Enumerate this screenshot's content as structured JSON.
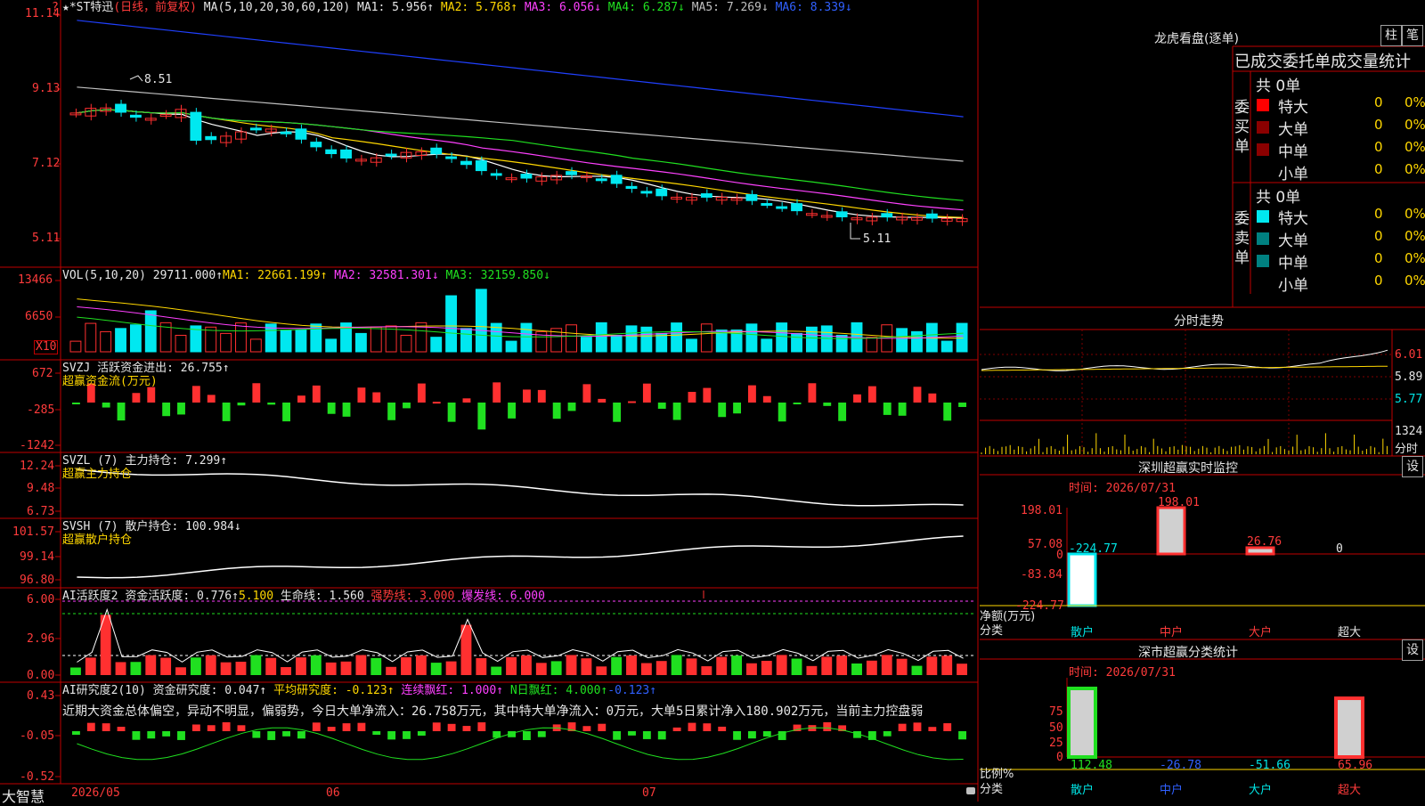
{
  "main_chart": {
    "header": {
      "name": "★*ST特迅",
      "period": "(日线，前复权)",
      "ma_label": "MA(5,10,20,30,60,120)",
      "ma1": "MA1: 5.956↑",
      "ma2": "MA2: 5.768↑",
      "ma3": "MA3: 6.056↓",
      "ma4": "MA4: 6.287↓",
      "ma5": "MA5: 7.269↓",
      "ma6": "MA6: 8.339↓"
    },
    "axis_labels": [
      "11.14",
      "9.13",
      "7.12",
      "5.11"
    ],
    "high_marker": "8.51",
    "low_marker": "5.11",
    "help_icon": "?"
  },
  "vol_panel": {
    "header": "VOL(5,10,20)",
    "val": "29711.000↑",
    "ma1": "MA1: 22661.199↑",
    "ma2": "MA2: 32581.301↓",
    "ma3": "MA3: 32159.850↓",
    "axis_labels": [
      "13466",
      "6650"
    ],
    "unit": "X10"
  },
  "svzj_panel": {
    "header": "SVZJ  活跃资金进出: 26.755↑",
    "sub": "超赢资金流(万元)",
    "axis_labels": [
      "672",
      "-285",
      "-1242"
    ]
  },
  "svzl_panel": {
    "header": "SVZL (7) 主力持仓: 7.299↑",
    "sub": "超赢主力持仓",
    "axis_labels": [
      "12.24",
      "9.48",
      "6.73"
    ]
  },
  "svsh_panel": {
    "header": "SVSH (7) 散户持仓: 100.984↓",
    "sub": "超赢散户持仓",
    "axis_labels": [
      "101.57",
      "99.14",
      "96.80"
    ]
  },
  "ai_active_panel": {
    "title": "AI活跃度2",
    "a1": "资金活跃度: 0.776↑",
    "a2": "5.100",
    "a3": "生命线: 1.560",
    "a4": "强势线: 3.000",
    "a5": "爆发线: 6.000",
    "axis_labels": [
      "6.00",
      "2.96",
      "0.00"
    ]
  },
  "ai_research_panel": {
    "title": "AI研究度2(10)",
    "r1": "资金研究度: 0.047↑",
    "r2": "平均研究度: -0.123↑",
    "r3": "连续飘红: 1.000↑",
    "r4": "N日飘红: 4.000↑",
    "r5": "-0.123↑",
    "commentary": "近期大资金总体偏空，异动不明显，偏弱势，今日大单净流入：26.758万元，其中特大单净流入：0万元，大单5日累计净入180.902万元，当前主力控盘弱",
    "axis_labels": [
      "0.43",
      "-0.05",
      "-0.52"
    ]
  },
  "bottom_bar": {
    "brand": "大智慧",
    "dates": [
      "2026/05",
      "06",
      "07"
    ]
  },
  "dragon_tiger": {
    "title": "龙虎看盘(逐单)",
    "btn1": "柱",
    "btn2": "笔",
    "subtitle": "已成交委托单成交量统计",
    "buy_group": {
      "side_label": [
        "委",
        "买",
        "单"
      ],
      "total": "共 0单",
      "rows": [
        {
          "label": "特大",
          "count": "0",
          "pct": "0%"
        },
        {
          "label": "大单",
          "count": "0",
          "pct": "0%"
        },
        {
          "label": "中单",
          "count": "0",
          "pct": "0%"
        },
        {
          "label": "小单",
          "count": "0",
          "pct": "0%"
        }
      ]
    },
    "sell_group": {
      "side_label": [
        "委",
        "卖",
        "单"
      ],
      "total": "共 0单",
      "rows": [
        {
          "label": "特大",
          "count": "0",
          "pct": "0%"
        },
        {
          "label": "大单",
          "count": "0",
          "pct": "0%"
        },
        {
          "label": "中单",
          "count": "0",
          "pct": "0%"
        },
        {
          "label": "小单",
          "count": "0",
          "pct": "0%"
        }
      ]
    }
  },
  "intraday": {
    "title": "分时走势",
    "price_labels": [
      "6.01",
      "5.89",
      "5.77"
    ],
    "vol_label": "1324",
    "vol_unit": "分时"
  },
  "sz_monitor": {
    "title": "深圳超赢实时监控",
    "settings": "设",
    "time": "时间: 2026/07/31",
    "axis_labels": [
      "198.01",
      "57.08",
      "0",
      "-83.84",
      "-224.77"
    ],
    "y_unit": "净额(万元)",
    "x_unit": "分类",
    "values": [
      "-224.77",
      "198.01",
      "26.76",
      "0"
    ],
    "categories": [
      "散户",
      "中户",
      "大户",
      "超大"
    ]
  },
  "sz_classify": {
    "title": "深市超赢分类统计",
    "settings": "设",
    "time": "时间: 2026/07/31",
    "axis_labels": [
      "75",
      "50",
      "25",
      "0"
    ],
    "y_unit": "比例%",
    "x_unit": "分类",
    "values": [
      "112.48",
      "-26.78",
      "-51.66",
      "65.96"
    ],
    "categories": [
      "散户",
      "中户",
      "大户",
      "超大"
    ]
  },
  "colors": {
    "up": "#ff3030",
    "down": "#00e8f0",
    "frame": "#c00000",
    "ma1": "#ffffff",
    "ma2": "#ffd700",
    "ma3": "#ff40ff",
    "ma4": "#20e020",
    "ma5": "#c0c0c0",
    "ma6": "#2040ff"
  }
}
